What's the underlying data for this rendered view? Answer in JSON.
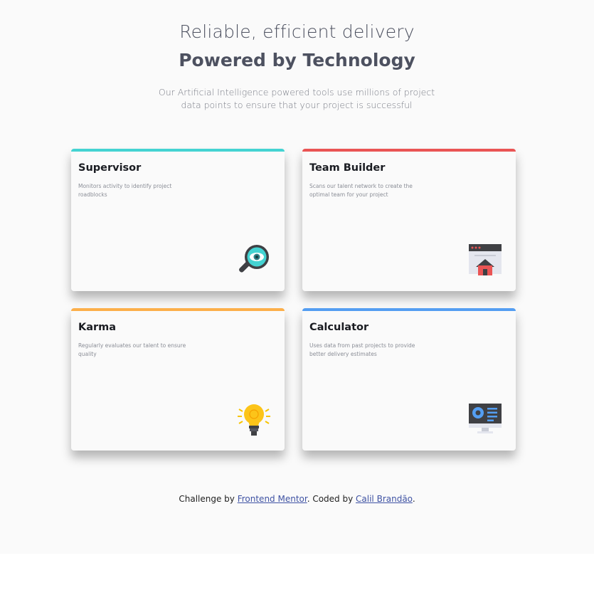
{
  "header": {
    "headline_light": "Reliable, efficient delivery",
    "headline_bold": "Powered by Technology",
    "description": "Our Artificial Intelligence powered tools use millions of project data points to ensure that your project is successful"
  },
  "cards": [
    {
      "title": "Supervisor",
      "description": "Monitors activity to identify project roadblocks",
      "accent": "#44d3d2",
      "icon": "supervisor-icon"
    },
    {
      "title": "Team Builder",
      "description": "Scans our talent network to create the optimal team for your project",
      "accent": "#ea5454",
      "icon": "team-builder-icon"
    },
    {
      "title": "Karma",
      "description": "Regularly evaluates our talent to ensure quality",
      "accent": "#fcaf4a",
      "icon": "karma-icon"
    },
    {
      "title": "Calculator",
      "description": "Uses data from past projects to provide better delivery estimates",
      "accent": "#549ef2",
      "icon": "calculator-icon"
    }
  ],
  "footer": {
    "prefix": "Challenge by ",
    "link1": "Frontend Mentor",
    "middle": ". Coded by ",
    "link2": "Calil Brandão",
    "suffix": "."
  }
}
